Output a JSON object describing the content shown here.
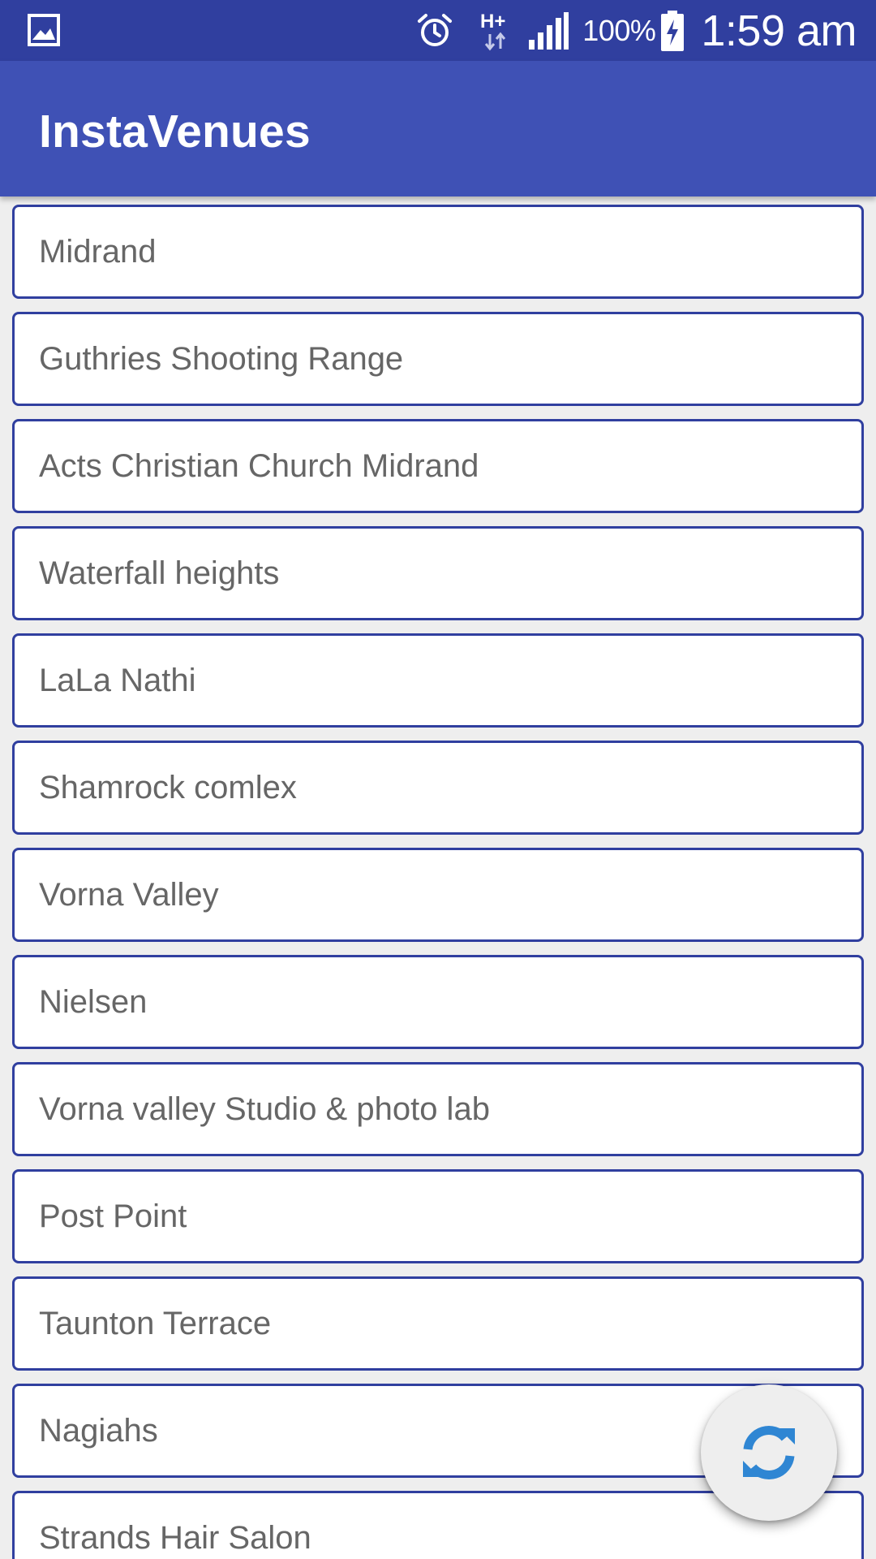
{
  "status_bar": {
    "left_icon": "image-notification-icon",
    "icons": [
      "alarm-icon",
      "h-plus-data-icon",
      "signal-icon",
      "battery-charging-icon"
    ],
    "battery_percent": "100%",
    "time": "1:59 am"
  },
  "app_bar": {
    "title": "InstaVenues"
  },
  "venues": [
    {
      "name": "Midrand"
    },
    {
      "name": "Guthries Shooting Range"
    },
    {
      "name": "Acts Christian Church Midrand"
    },
    {
      "name": "Waterfall heights"
    },
    {
      "name": "LaLa Nathi"
    },
    {
      "name": "Shamrock comlex"
    },
    {
      "name": "Vorna Valley"
    },
    {
      "name": "Nielsen"
    },
    {
      "name": "Vorna valley Studio & photo lab"
    },
    {
      "name": "Post Point"
    },
    {
      "name": "Taunton Terrace"
    },
    {
      "name": "Nagiahs"
    },
    {
      "name": "Strands Hair Salon"
    }
  ],
  "fab": {
    "icon": "refresh-icon"
  },
  "colors": {
    "status_bar": "#303f9f",
    "app_bar": "#3f51b5",
    "item_border": "#303f9f",
    "fab_icon": "#2f86d3",
    "background": "#eeeeee"
  }
}
